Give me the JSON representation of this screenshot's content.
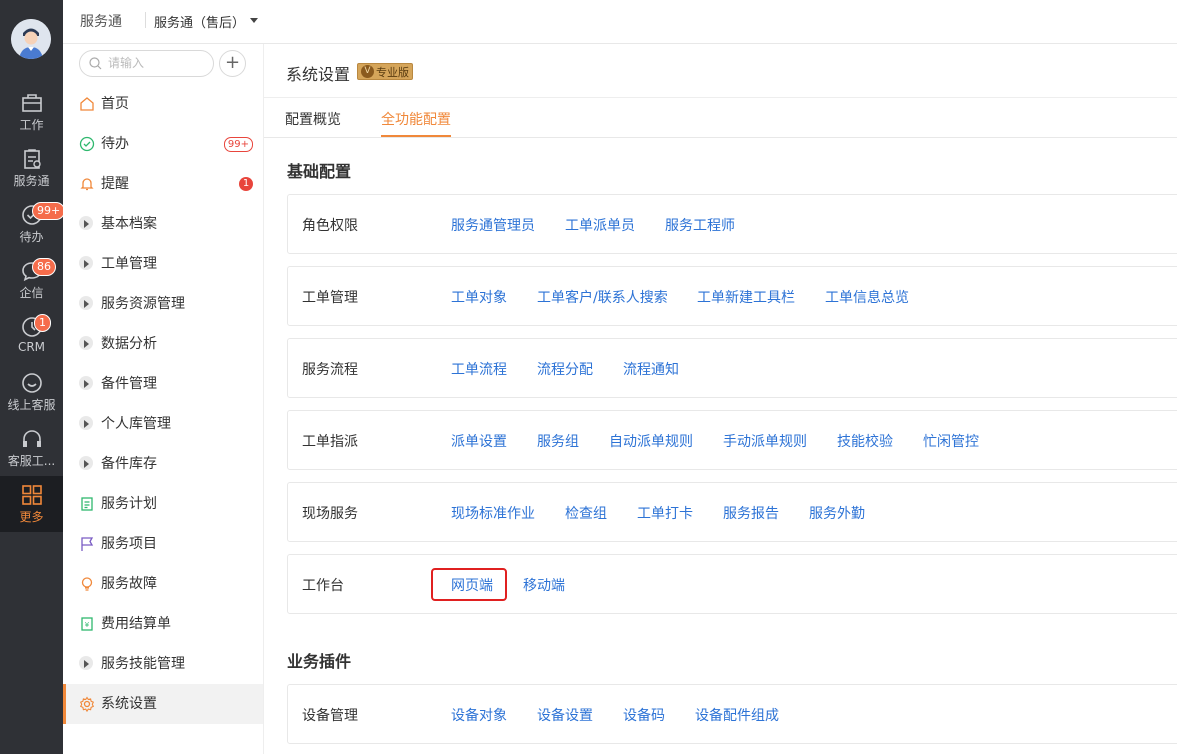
{
  "rail": {
    "items": [
      {
        "label": "工作",
        "icon": "briefcase-icon"
      },
      {
        "label": "服务通",
        "icon": "service-icon"
      },
      {
        "label": "待办",
        "icon": "check-circle-icon",
        "badge": "99+"
      },
      {
        "label": "企信",
        "icon": "chat-icon",
        "badge": "86"
      },
      {
        "label": "CRM",
        "icon": "clock-icon",
        "badge": "1"
      },
      {
        "label": "线上客服",
        "icon": "smile-chat-icon"
      },
      {
        "label": "客服工...",
        "icon": "headset-icon"
      },
      {
        "label": "更多",
        "icon": "grid-icon"
      }
    ]
  },
  "topbar": {
    "brand": "服务通",
    "app_select": "服务通（售后）"
  },
  "menu": {
    "search_placeholder": "请输入",
    "items": [
      {
        "label": "首页",
        "icon": "home-icon"
      },
      {
        "label": "待办",
        "icon": "check-icon",
        "badge": "99+"
      },
      {
        "label": "提醒",
        "icon": "bell-icon",
        "badge": "1"
      },
      {
        "label": "基本档案",
        "icon": "expand-icon"
      },
      {
        "label": "工单管理",
        "icon": "expand-icon"
      },
      {
        "label": "服务资源管理",
        "icon": "expand-icon"
      },
      {
        "label": "数据分析",
        "icon": "expand-icon"
      },
      {
        "label": "备件管理",
        "icon": "expand-icon"
      },
      {
        "label": "个人库管理",
        "icon": "expand-icon"
      },
      {
        "label": "备件库存",
        "icon": "expand-icon"
      },
      {
        "label": "服务计划",
        "icon": "clipboard-icon"
      },
      {
        "label": "服务项目",
        "icon": "flag-icon"
      },
      {
        "label": "服务故障",
        "icon": "bulb-icon"
      },
      {
        "label": "费用结算单",
        "icon": "invoice-icon"
      },
      {
        "label": "服务技能管理",
        "icon": "expand-icon"
      },
      {
        "label": "系统设置",
        "icon": "gear-icon"
      }
    ]
  },
  "page": {
    "title": "系统设置",
    "edition": "专业版",
    "tabs": [
      "配置概览",
      "全功能配置"
    ],
    "sections": [
      {
        "title": "基础配置",
        "rows": [
          {
            "label": "角色权限",
            "links": [
              "服务通管理员",
              "工单派单员",
              "服务工程师"
            ]
          },
          {
            "label": "工单管理",
            "links": [
              "工单对象",
              "工单客户/联系人搜索",
              "工单新建工具栏",
              "工单信息总览"
            ]
          },
          {
            "label": "服务流程",
            "links": [
              "工单流程",
              "流程分配",
              "流程通知"
            ]
          },
          {
            "label": "工单指派",
            "links": [
              "派单设置",
              "服务组",
              "自动派单规则",
              "手动派单规则",
              "技能校验",
              "忙闲管控"
            ]
          },
          {
            "label": "现场服务",
            "links": [
              "现场标准作业",
              "检查组",
              "工单打卡",
              "服务报告",
              "服务外勤"
            ]
          },
          {
            "label": "工作台",
            "links": [
              "网页端",
              "移动端"
            ]
          }
        ]
      },
      {
        "title": "业务插件",
        "rows": [
          {
            "label": "设备管理",
            "links": [
              "设备对象",
              "设备设置",
              "设备码",
              "设备配件组成"
            ]
          }
        ]
      }
    ]
  },
  "colors": {
    "accent": "#f0883a",
    "link": "#2d73d6",
    "badge": "#e8453c",
    "rail": "#2f3136"
  }
}
